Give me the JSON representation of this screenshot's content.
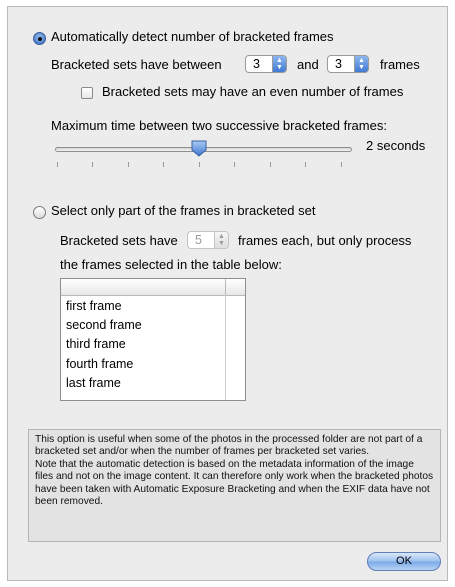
{
  "auto_detect": {
    "radio_label": "Automatically detect number of bracketed frames",
    "between_prefix": "Bracketed sets have between",
    "min_value": "3",
    "and_text": "and",
    "max_value": "3",
    "frames_suffix": "frames",
    "even_checkbox_label": "Bracketed sets may have an even number of frames",
    "max_time_label": "Maximum time between two successive bracketed frames:",
    "slider_value_text": "2 seconds",
    "slider_level": 0.5
  },
  "select_part": {
    "radio_label": "Select only part of the frames in bracketed set",
    "have_prefix": "Bracketed sets have",
    "frames_count": "5",
    "each_suffix": "frames each, but only process",
    "line2": "the frames selected in the table below:",
    "frames": [
      "first frame",
      "second frame",
      "third frame",
      "fourth frame",
      "last frame"
    ]
  },
  "info_text": "This option is useful when some of the photos in the processed folder are not part of a bracketed set and/or when the number of frames per bracketed set varies.\nNote that the automatic detection is based on the metadata information of the image files and not on the image content. It can therefore only work when the bracketed photos have been taken with Automatic Exposure Bracketing and when the EXIF data have not been removed.",
  "ok_label": "OK",
  "colors": {
    "accent": "#3f79d2",
    "dialog_bg": "#ececec"
  }
}
